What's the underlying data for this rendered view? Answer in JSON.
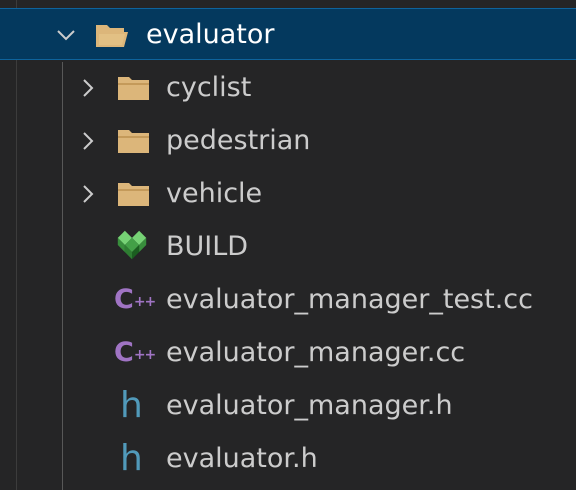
{
  "explorer": {
    "root": {
      "label": "evaluator",
      "expanded": true,
      "icon": "folder-open-icon"
    },
    "children": [
      {
        "label": "cyclist",
        "type": "folder",
        "icon": "folder-icon"
      },
      {
        "label": "pedestrian",
        "type": "folder",
        "icon": "folder-icon"
      },
      {
        "label": "vehicle",
        "type": "folder",
        "icon": "folder-icon"
      },
      {
        "label": "BUILD",
        "type": "bazel",
        "icon": "bazel-icon"
      },
      {
        "label": "evaluator_manager_test.cc",
        "type": "cpp",
        "icon": "cpp-icon",
        "glyph": "C",
        "glyph_suffix": "++"
      },
      {
        "label": "evaluator_manager.cc",
        "type": "cpp",
        "icon": "cpp-icon",
        "glyph": "C",
        "glyph_suffix": "++"
      },
      {
        "label": "evaluator_manager.h",
        "type": "header",
        "icon": "h-icon",
        "glyph": "h"
      },
      {
        "label": "evaluator.h",
        "type": "header",
        "icon": "h-icon",
        "glyph": "h"
      }
    ]
  },
  "colors": {
    "background": "#252526",
    "selection": "#04395e",
    "selection_border": "#0e639c",
    "folder": "#dcb67a",
    "cpp": "#a074c4",
    "header": "#519aba",
    "bazel": "#76d275"
  }
}
